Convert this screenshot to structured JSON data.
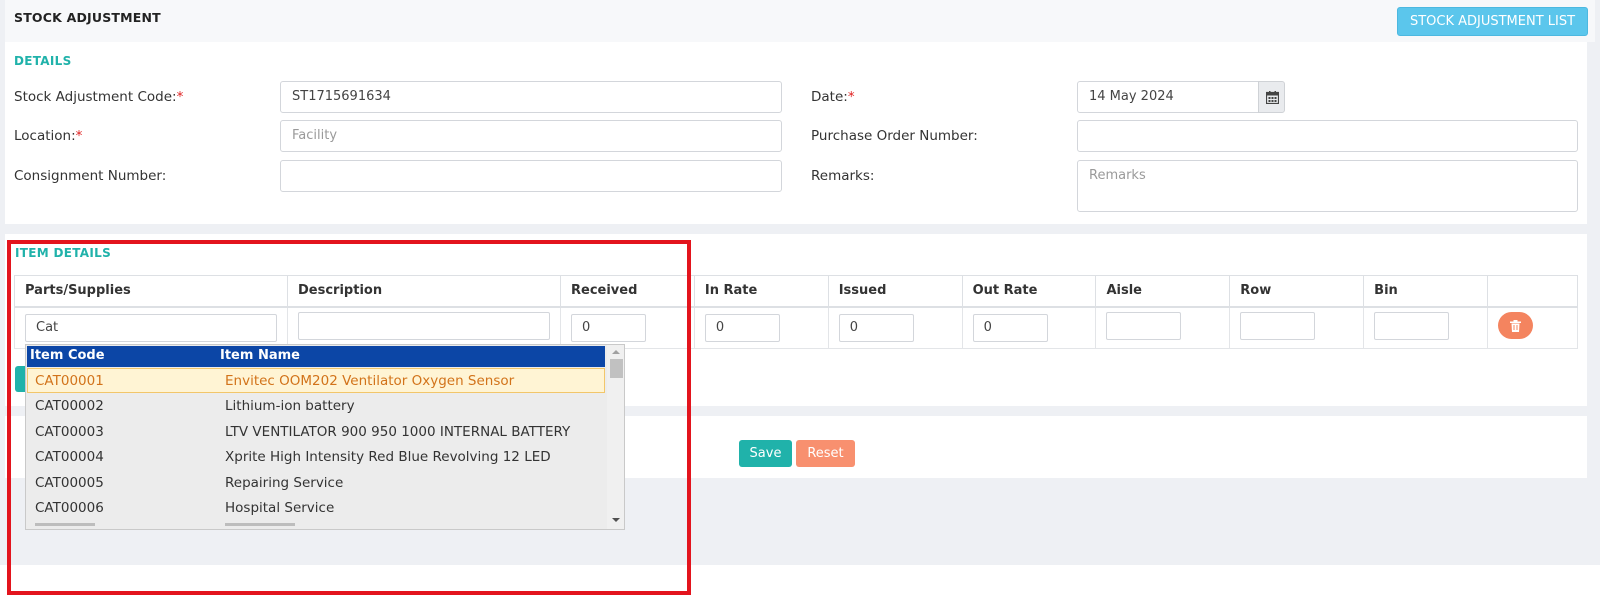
{
  "page": {
    "title": "STOCK ADJUSTMENT",
    "list_button": "STOCK ADJUSTMENT LIST"
  },
  "details": {
    "title": "DETAILS",
    "code_label": "Stock Adjustment Code:",
    "code_value": "ST1715691634",
    "date_label": "Date:",
    "date_value": "14 May 2024",
    "location_label": "Location:",
    "location_placeholder": "Facility",
    "po_label": "Purchase Order Number:",
    "po_value": "",
    "consignment_label": "Consignment Number:",
    "consignment_value": "",
    "remarks_label": "Remarks:",
    "remarks_placeholder": "Remarks",
    "required_mark": "*"
  },
  "items": {
    "title": "ITEM DETAILS",
    "columns": [
      "Parts/Supplies",
      "Description",
      "Received",
      "In Rate",
      "Issued",
      "Out Rate",
      "Aisle",
      "Row",
      "Bin",
      ""
    ],
    "row": {
      "parts": "Cat",
      "description": "",
      "received": "0",
      "in_rate": "0",
      "issued": "0",
      "out_rate": "0",
      "aisle": "",
      "row": "",
      "bin": ""
    }
  },
  "autocomplete": {
    "headers": {
      "code": "Item Code",
      "name": "Item Name"
    },
    "options": [
      {
        "code": "CAT00001",
        "name": "Envitec OOM202 Ventilator Oxygen Sensor"
      },
      {
        "code": "CAT00002",
        "name": "Lithium-ion battery"
      },
      {
        "code": "CAT00003",
        "name": "LTV VENTILATOR 900 950 1000 INTERNAL BATTERY"
      },
      {
        "code": "CAT00004",
        "name": "Xprite High Intensity Red Blue Revolving 12 LED"
      },
      {
        "code": "CAT00005",
        "name": "Repairing Service"
      },
      {
        "code": "CAT00006",
        "name": "Hospital Service"
      }
    ]
  },
  "actions": {
    "save": "Save",
    "reset": "Reset"
  },
  "colors": {
    "accent_teal": "#20b2aa",
    "list_button_blue": "#5bc6ec",
    "reset_orange": "#f8906f",
    "dropdown_header": "#0c46a6",
    "highlight_red": "#e3141d"
  },
  "icons": [
    "calendar-icon",
    "trash-icon",
    "scroll-up-icon",
    "scroll-down-icon"
  ]
}
